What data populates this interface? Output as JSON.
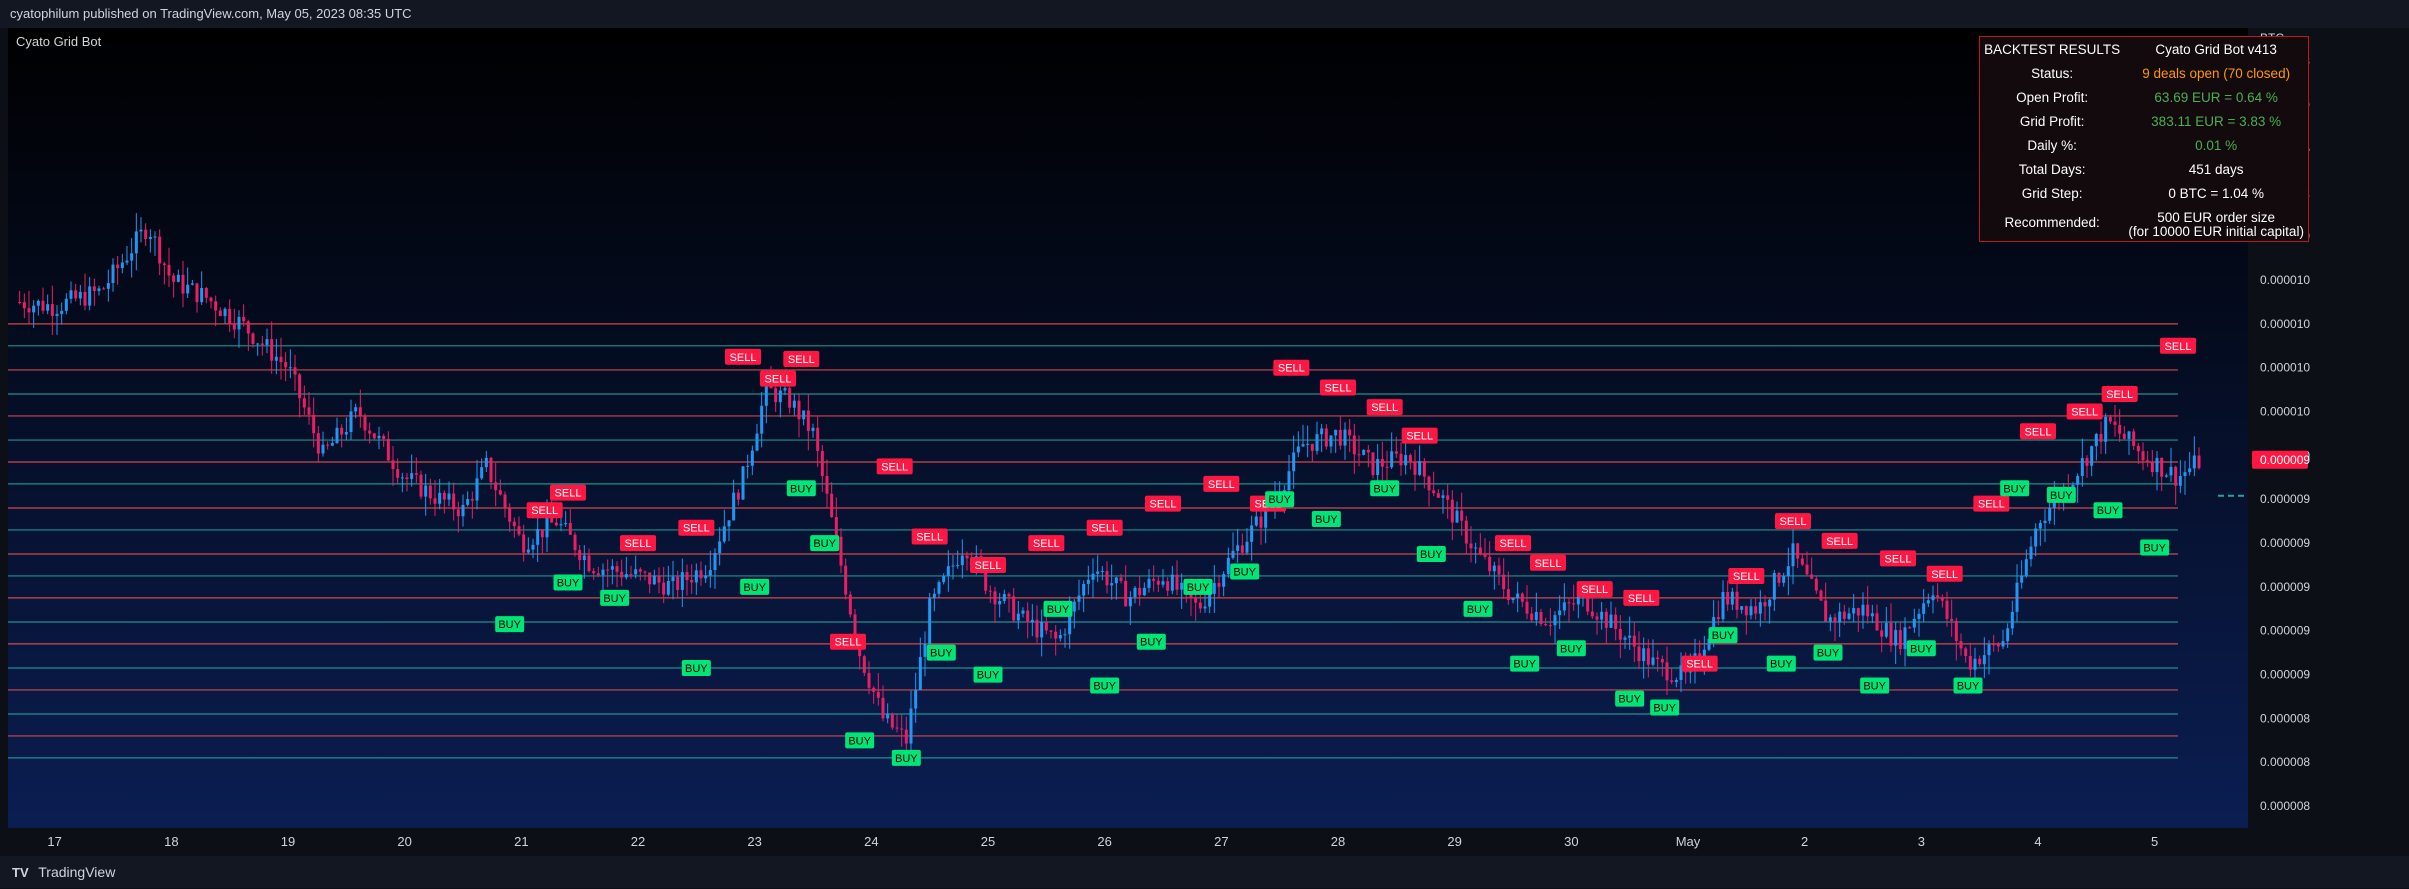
{
  "header": {
    "published_text": "cyatophilum published on TradingView.com, May 05, 2023 08:35 UTC"
  },
  "footer": {
    "brand": "TradingView",
    "logo_text": "TV"
  },
  "chart_title": "Cyato Grid Bot",
  "backtest": {
    "header_left": "BACKTEST RESULTS",
    "header_right": "Cyato Grid Bot v413",
    "rows": [
      {
        "label": "Status:",
        "value": "9 deals open (70 closed)",
        "color": "#ff9800"
      },
      {
        "label": "Open Profit:",
        "value": "63.69 EUR = 0.64 %",
        "color": "#4caf50"
      },
      {
        "label": "Grid Profit:",
        "value": "383.11 EUR = 3.83 %",
        "color": "#4caf50"
      },
      {
        "label": "Daily %:",
        "value": "0.01 %",
        "color": "#4caf50"
      },
      {
        "label": "Total Days:",
        "value": "451 days",
        "color": "#ffffff"
      },
      {
        "label": "Grid Step:",
        "value": "0 BTC = 1.04 %",
        "color": "#ffffff"
      }
    ],
    "recommended_label": "Recommended:",
    "recommended_line1": "500 EUR order size",
    "recommended_line2": "(for 10000 EUR initial capital)"
  },
  "colors": {
    "up": "#2196f3",
    "down": "#e91e63",
    "grid_line_green": "#26a69a",
    "grid_line_red": "#ef5350",
    "sell_badge": "#ff1744",
    "buy_badge": "#00e676",
    "current_price_badge": "#ff1744"
  },
  "chart_data": {
    "type": "candlestick",
    "title": "Cyato Grid Bot",
    "currency": "BTC",
    "x_tick_labels": [
      "17",
      "18",
      "19",
      "20",
      "21",
      "22",
      "23",
      "24",
      "25",
      "26",
      "27",
      "28",
      "29",
      "30",
      "May",
      "2",
      "3",
      "4",
      "5"
    ],
    "y_ticks": [
      "0.00001180",
      "0.00001160",
      "0.00001140",
      "0.00001120",
      "0.00001100",
      "0.00001080",
      "0.00001060",
      "0.00001040",
      "0.00001020",
      "0.00001000",
      "0.00000980",
      "0.00000960",
      "0.00000940",
      "0.00000920",
      "0.00000900",
      "0.00000880",
      "0.00000860",
      "0.00000840"
    ],
    "ylim": [
      8.3e-06,
      1.195e-05
    ],
    "current_price": "0.00000998",
    "grid_levels": [
      1.06e-05,
      1.05e-05,
      1.039e-05,
      1.028e-05,
      1.018e-05,
      1.007e-05,
      9.97e-06,
      9.87e-06,
      9.76e-06,
      9.66e-06,
      9.55e-06,
      9.45e-06,
      9.35e-06,
      9.24e-06,
      9.14e-06,
      9.03e-06,
      8.93e-06,
      8.82e-06,
      8.72e-06,
      8.62e-06
    ],
    "price_path_days": [
      16.7,
      17.0,
      17.4,
      17.6,
      17.8,
      18.0,
      18.3,
      18.6,
      19.0,
      19.3,
      19.6,
      20.0,
      20.3,
      20.5,
      20.7,
      21.0,
      21.3,
      21.6,
      22.0,
      22.3,
      22.6,
      22.9,
      23.1,
      23.3,
      23.5,
      23.7,
      23.9,
      24.1,
      24.3,
      24.5,
      24.8,
      25.0,
      25.3,
      25.6,
      25.9,
      26.2,
      26.5,
      26.8,
      27.1,
      27.4,
      27.7,
      28.0,
      28.3,
      28.6,
      28.9,
      29.2,
      29.5,
      29.8,
      30.1,
      30.4,
      30.7,
      31.0,
      31.3,
      31.6,
      31.9,
      32.2,
      32.5,
      32.8,
      33.1,
      33.4,
      33.7,
      34.0,
      34.3,
      34.6,
      34.9,
      35.2,
      35.4
    ],
    "price_path_values": [
      1.07e-05,
      1.068e-05,
      1.075e-05,
      1.09e-05,
      1.105e-05,
      1.08e-05,
      1.072e-05,
      1.06e-05,
      1.04e-05,
      1e-05,
      1.02e-05,
      9.9e-06,
      9.8e-06,
      9.75e-06,
      9.95e-06,
      9.6e-06,
      9.7e-06,
      9.5e-06,
      9.45e-06,
      9.4e-06,
      9.5e-06,
      9.9e-06,
      1.03e-05,
      1.025e-05,
      1.01e-05,
      9.6e-06,
      9.1e-06,
      8.8e-06,
      8.7e-06,
      9.3e-06,
      9.6e-06,
      9.4e-06,
      9.25e-06,
      9.15e-06,
      9.5e-06,
      9.35e-06,
      9.45e-06,
      9.3e-06,
      9.55e-06,
      9.75e-06,
      1.005e-05,
      1.01e-05,
      9.95e-06,
      1e-05,
      9.8e-06,
      9.55e-06,
      9.35e-06,
      9.25e-06,
      9.35e-06,
      9.2e-06,
      9.05e-06,
      8.98e-06,
      9.35e-06,
      9.3e-06,
      9.55e-06,
      9.25e-06,
      9.3e-06,
      9.15e-06,
      9.4e-06,
      9.05e-06,
      9.15e-06,
      9.7e-06,
      9.9e-06,
      1.015e-05,
      1e-05,
      9.9e-06,
      9.98e-06
    ],
    "sell_signals": [
      [
        21.2,
        9.75e-06
      ],
      [
        21.4,
        9.83e-06
      ],
      [
        22.0,
        9.6e-06
      ],
      [
        22.5,
        9.67e-06
      ],
      [
        22.9,
        1.045e-05
      ],
      [
        23.2,
        1.035e-05
      ],
      [
        23.4,
        1.044e-05
      ],
      [
        23.8,
        9.15e-06
      ],
      [
        24.2,
        9.95e-06
      ],
      [
        24.5,
        9.63e-06
      ],
      [
        25.0,
        9.5e-06
      ],
      [
        25.5,
        9.6e-06
      ],
      [
        26.0,
        9.67e-06
      ],
      [
        26.5,
        9.78e-06
      ],
      [
        27.0,
        9.87e-06
      ],
      [
        27.4,
        9.78e-06
      ],
      [
        27.6,
        1.04e-05
      ],
      [
        28.0,
        1.031e-05
      ],
      [
        28.4,
        1.022e-05
      ],
      [
        28.7,
        1.009e-05
      ],
      [
        29.5,
        9.6e-06
      ],
      [
        29.8,
        9.51e-06
      ],
      [
        30.2,
        9.39e-06
      ],
      [
        30.6,
        9.35e-06
      ],
      [
        31.1,
        9.05e-06
      ],
      [
        31.5,
        9.45e-06
      ],
      [
        31.9,
        9.7e-06
      ],
      [
        32.3,
        9.61e-06
      ],
      [
        32.8,
        9.53e-06
      ],
      [
        33.2,
        9.46e-06
      ],
      [
        33.6,
        9.78e-06
      ],
      [
        34.0,
        1.011e-05
      ],
      [
        34.4,
        1.02e-05
      ],
      [
        34.7,
        1.028e-05
      ],
      [
        35.2,
        1.05e-05
      ]
    ],
    "buy_signals": [
      [
        20.9,
        9.23e-06
      ],
      [
        21.4,
        9.42e-06
      ],
      [
        21.8,
        9.35e-06
      ],
      [
        22.5,
        9.03e-06
      ],
      [
        23.0,
        9.4e-06
      ],
      [
        23.4,
        9.85e-06
      ],
      [
        23.6,
        9.6e-06
      ],
      [
        23.9,
        8.7e-06
      ],
      [
        24.3,
        8.62e-06
      ],
      [
        24.6,
        9.1e-06
      ],
      [
        25.0,
        9e-06
      ],
      [
        25.6,
        9.3e-06
      ],
      [
        26.0,
        8.95e-06
      ],
      [
        26.4,
        9.15e-06
      ],
      [
        26.8,
        9.4e-06
      ],
      [
        27.2,
        9.47e-06
      ],
      [
        27.5,
        9.8e-06
      ],
      [
        27.9,
        9.71e-06
      ],
      [
        28.4,
        9.85e-06
      ],
      [
        28.8,
        9.55e-06
      ],
      [
        29.2,
        9.3e-06
      ],
      [
        29.6,
        9.05e-06
      ],
      [
        30.0,
        9.12e-06
      ],
      [
        30.5,
        8.89e-06
      ],
      [
        30.8,
        8.85e-06
      ],
      [
        31.3,
        9.18e-06
      ],
      [
        31.8,
        9.05e-06
      ],
      [
        32.2,
        9.1e-06
      ],
      [
        32.6,
        8.95e-06
      ],
      [
        33.0,
        9.12e-06
      ],
      [
        33.4,
        8.95e-06
      ],
      [
        33.8,
        9.85e-06
      ],
      [
        34.2,
        9.82e-06
      ],
      [
        34.6,
        9.75e-06
      ],
      [
        35.0,
        9.58e-06
      ]
    ]
  }
}
